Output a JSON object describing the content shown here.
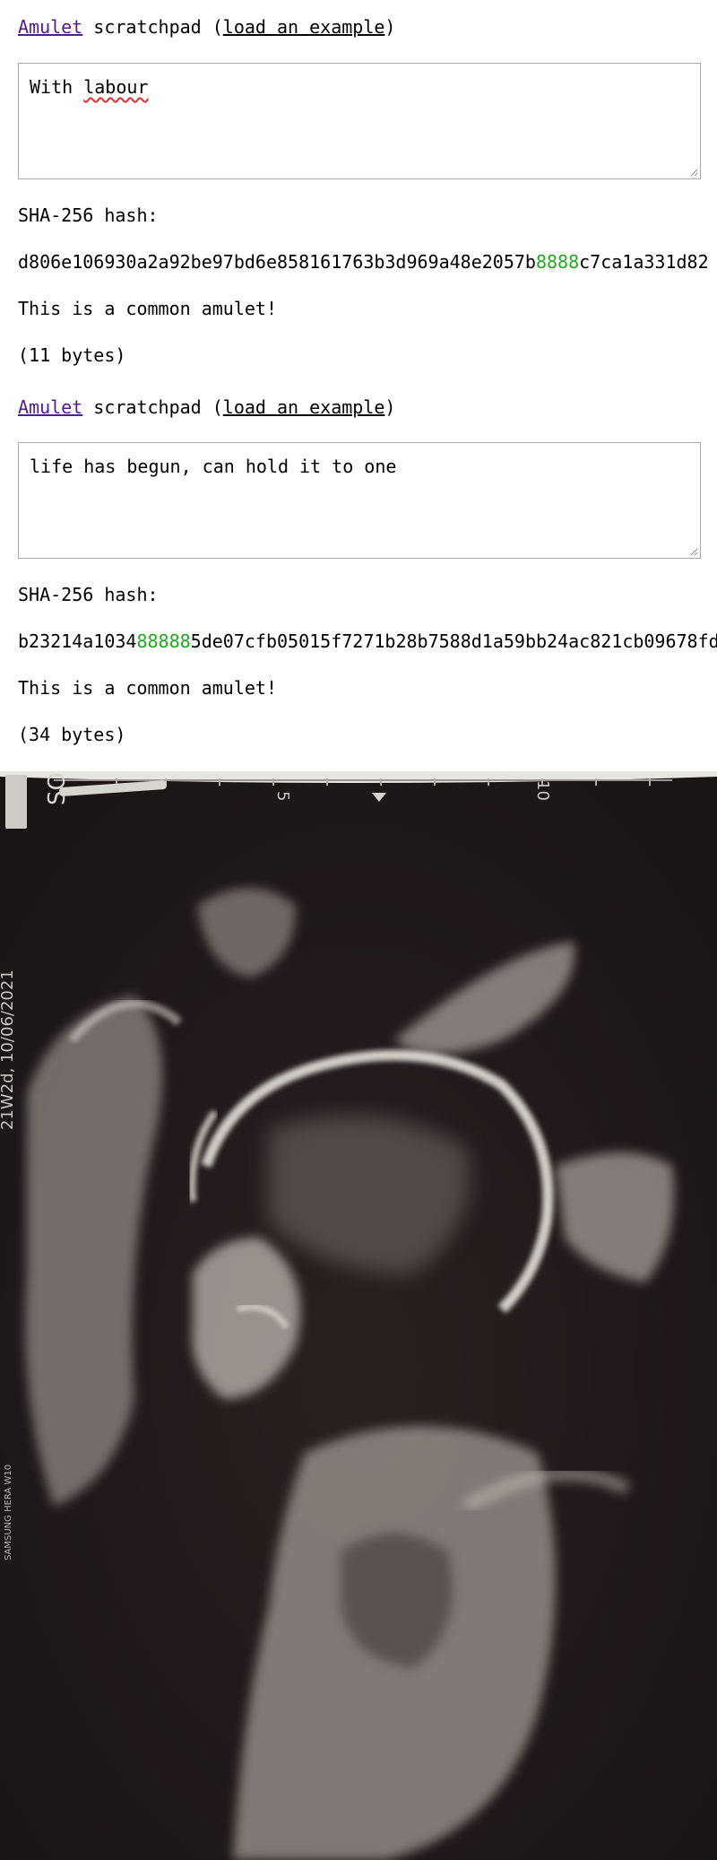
{
  "pads": [
    {
      "heading": {
        "link": "Amulet",
        "middle": " scratchpad (",
        "example": "load an example",
        "close": ")"
      },
      "text_first": "With ",
      "text_spell": "labour",
      "hash_label": "SHA-256 hash:",
      "hash_pre": "d806e106930a2a92be97bd6e858161763b3d969a48e2057b",
      "hash_hl": "8888",
      "hash_post": "c7ca1a331d82",
      "verdict": "This is a common amulet!",
      "bytes": "(11 bytes)"
    },
    {
      "heading": {
        "link": "Amulet",
        "middle": " scratchpad (",
        "example": "load an example",
        "close": ")"
      },
      "text": "life has begun, can hold it to one",
      "hash_label": "SHA-256 hash:",
      "hash_pre": "b23214a1034",
      "hash_hl": "88888",
      "hash_post": "5de07cfb05015f7271b28b7588d1a59bb24ac821cb09678fd",
      "verdict": "This is a common amulet!",
      "bytes": "(34 bytes)"
    }
  ],
  "photo": {
    "side_text": "21W2d, 10/06/2021",
    "scale_mark_5": "5",
    "scale_mark_10": "10",
    "corner_text": "SO",
    "device_text": "SAMSUNG HERA W10",
    "highlight_color": "#22aa22",
    "link_color": "#551a8b"
  }
}
